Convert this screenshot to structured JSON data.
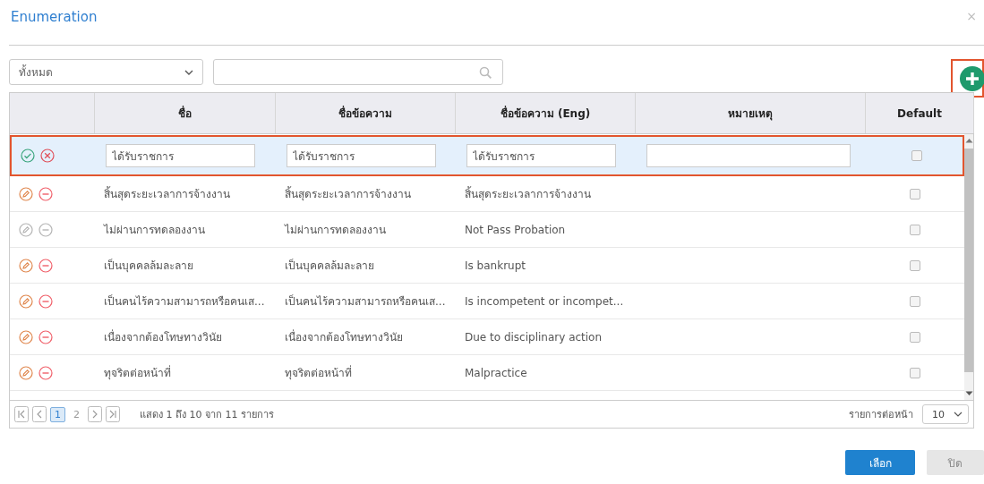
{
  "dialog": {
    "title": "Enumeration",
    "close": "×"
  },
  "filter": {
    "value": "ทั้งหมด"
  },
  "table": {
    "columns": [
      "ชื่อ",
      "ชื่อข้อความ",
      "ชื่อข้อความ (Eng)",
      "หมายเหตุ",
      "Default"
    ],
    "rows": [
      {
        "kind": "editing",
        "selected": true,
        "name": "ได้รับราชการ",
        "message": "ได้รับราชการ",
        "message_eng": "ได้รับราชการ",
        "default": false
      },
      {
        "kind": "view",
        "selected": false,
        "name": "สิ้นสุดระยะเวลาการจ้างงาน",
        "message": "สิ้นสุดระยะเวลาการจ้างงาน",
        "message_eng": "สิ้นสุดระยะเวลาการจ้างงาน",
        "default": false,
        "disabled": false
      },
      {
        "kind": "view",
        "selected": false,
        "name": "ไม่ผ่านการทดลองงาน",
        "message": "ไม่ผ่านการทดลองงาน",
        "message_eng": "Not Pass Probation",
        "default": false,
        "disabled": true
      },
      {
        "kind": "view",
        "selected": false,
        "name": "เป็นบุคคลล้มละลาย",
        "message": "เป็นบุคคลล้มละลาย",
        "message_eng": "Is bankrupt",
        "default": false,
        "disabled": false
      },
      {
        "kind": "view",
        "selected": false,
        "name": "เป็นคนไร้ความสามารถหรือคนเส...",
        "message": "เป็นคนไร้ความสามารถหรือคนเส...",
        "message_eng": "Is incompetent or incompet...",
        "default": false,
        "disabled": false
      },
      {
        "kind": "view",
        "selected": false,
        "name": "เนื่องจากต้องโทษทางวินัย",
        "message": "เนื่องจากต้องโทษทางวินัย",
        "message_eng": "Due to disciplinary action",
        "default": false,
        "disabled": false
      },
      {
        "kind": "view",
        "selected": false,
        "name": "ทุจริตต่อหน้าที่",
        "message": "ทุจริตต่อหน้าที่",
        "message_eng": "Malpractice",
        "default": false,
        "disabled": false
      }
    ]
  },
  "pager": {
    "pages": [
      {
        "label": "1",
        "selected": true
      },
      {
        "label": "2",
        "selected": false
      }
    ],
    "summary": "แสดง 1 ถึง 10 จาก 11 รายการ",
    "page_size_label": "รายการต่อหน้า",
    "page_size": "10"
  },
  "buttons": [
    {
      "label": "เลือก",
      "kind": "primary"
    },
    {
      "label": "ปิด",
      "kind": "secondary"
    }
  ]
}
